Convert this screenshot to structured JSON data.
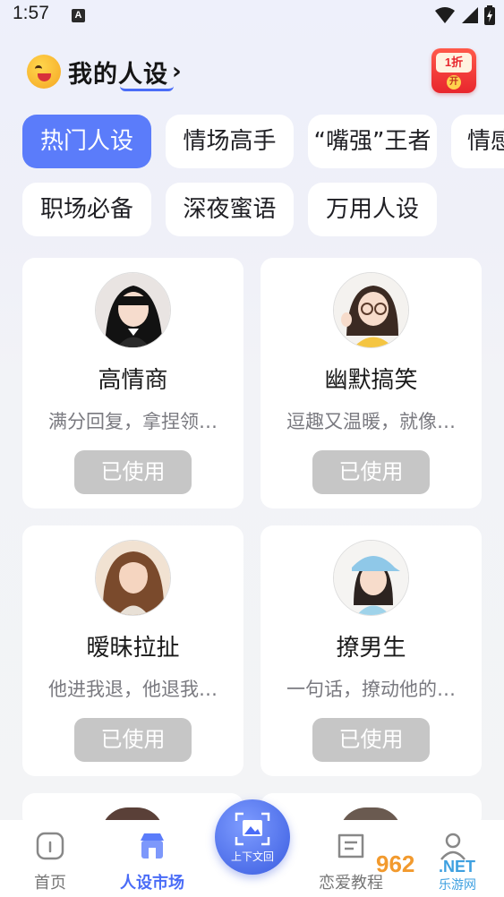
{
  "status_bar": {
    "time": "1:57",
    "notif_letter": "A"
  },
  "header": {
    "title": "我的人设",
    "chevron": "›",
    "icon": "laughing-emoji-icon"
  },
  "promo": {
    "top_text": "1折",
    "bottom_text": "开"
  },
  "categories": [
    "热门人设",
    "情场高手",
    "“嘴强”王者",
    "情感",
    "职场必备",
    "深夜蜜语",
    "万用人设"
  ],
  "active_category": "热门人设",
  "cards": [
    {
      "title": "高情商",
      "desc": "满分回复，拿捏领…",
      "button": "已使用"
    },
    {
      "title": "幽默搞笑",
      "desc": "逗趣又温暖，就像…",
      "button": "已使用"
    },
    {
      "title": "暧昧拉扯",
      "desc": "他进我退，他退我…",
      "button": "已使用"
    },
    {
      "title": "撩男生",
      "desc": "一句话，撩动他的…",
      "button": "已使用"
    }
  ],
  "bottom_nav": {
    "items": [
      {
        "label": "首页",
        "icon": "home-icon"
      },
      {
        "label": "人设市场",
        "icon": "store-icon"
      },
      {
        "label": "恋爱教程",
        "icon": "book-icon"
      },
      {
        "label": "",
        "icon": "profile-icon"
      }
    ],
    "center_label": "上下文回",
    "active": "人设市场"
  },
  "watermark": {
    "number": "962",
    "domain": ".NET",
    "sub": "乐游网"
  },
  "colors": {
    "accent": "#5b7cfa",
    "used_button": "#c6c6c6",
    "promo": "#e8262d"
  }
}
